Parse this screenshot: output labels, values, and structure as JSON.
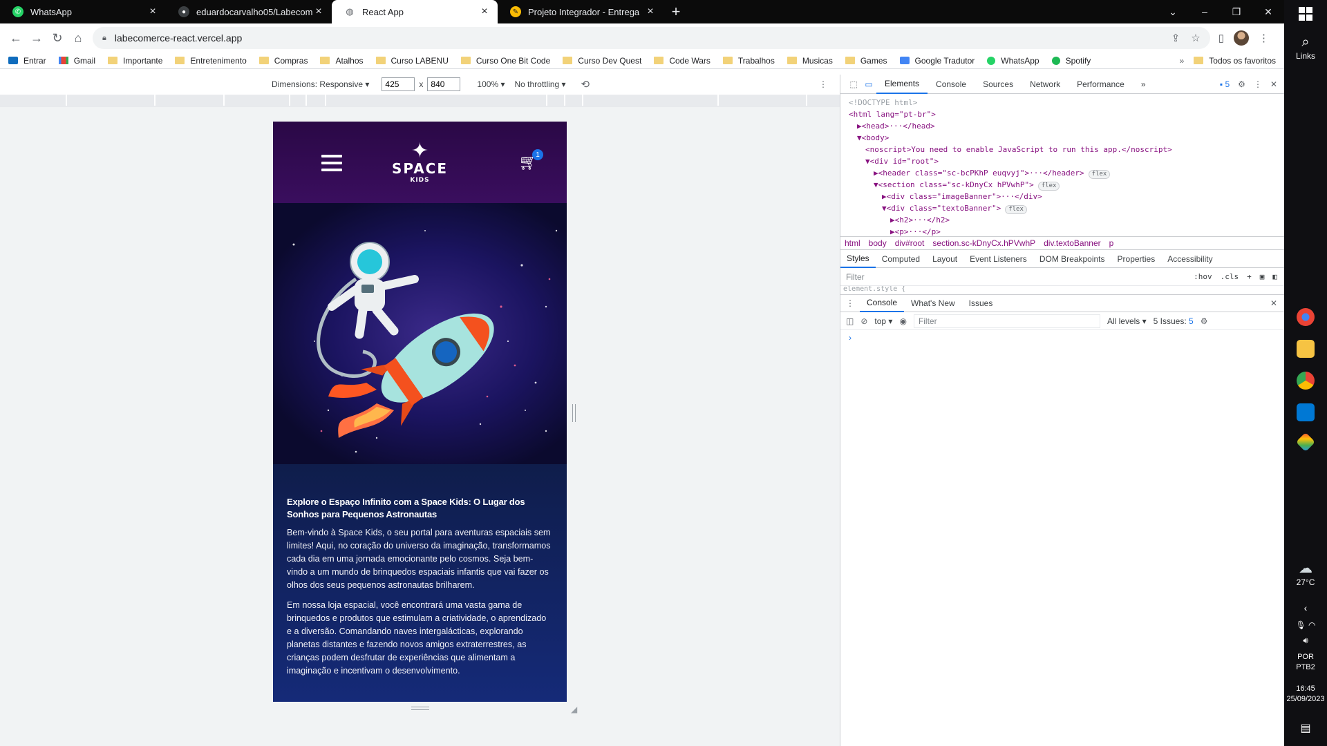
{
  "browser": {
    "tabs": [
      {
        "title": "WhatsApp",
        "favicon": "whatsapp-icon",
        "color": "#25d366"
      },
      {
        "title": "eduardocarvalho05/Labecomerce",
        "favicon": "github-icon",
        "color": "#5f6368"
      },
      {
        "title": "React App",
        "favicon": "globe-icon",
        "color": "#5f6368"
      },
      {
        "title": "Projeto Integrador - Entrega",
        "favicon": "pencil-icon",
        "color": "#fbbc04"
      }
    ],
    "url": "labecomerce-react.vercel.app",
    "bookmarks": [
      {
        "label": "Entrar",
        "icon": "outlook-icon"
      },
      {
        "label": "Gmail",
        "icon": "gmail-icon"
      },
      {
        "label": "Importante",
        "icon": "folder-icon"
      },
      {
        "label": "Entretenimento",
        "icon": "folder-icon"
      },
      {
        "label": "Compras",
        "icon": "folder-icon"
      },
      {
        "label": "Atalhos",
        "icon": "folder-icon"
      },
      {
        "label": "Curso LABENU",
        "icon": "folder-icon"
      },
      {
        "label": "Curso One Bit Code",
        "icon": "folder-icon"
      },
      {
        "label": "Curso Dev Quest",
        "icon": "folder-icon"
      },
      {
        "label": "Code Wars",
        "icon": "folder-icon"
      },
      {
        "label": "Trabalhos",
        "icon": "folder-icon"
      },
      {
        "label": "Musicas",
        "icon": "folder-icon"
      },
      {
        "label": "Games",
        "icon": "folder-icon"
      },
      {
        "label": "Google Tradutor",
        "icon": "translate-icon"
      },
      {
        "label": "WhatsApp",
        "icon": "whatsapp-icon"
      },
      {
        "label": "Spotify",
        "icon": "spotify-icon"
      }
    ],
    "bookmarks_more": "»",
    "all_bookmarks": "Todos os favoritos"
  },
  "device_toolbar": {
    "dimensions_label": "Dimensions: Responsive",
    "width": "425",
    "height": "840",
    "times": "x",
    "zoom": "100%",
    "throttling": "No throttling"
  },
  "site": {
    "logo_name": "SPACE",
    "logo_sub": "KIDS",
    "cart_count": "1",
    "heading": "Explore o Espaço Infinito com a Space Kids: O Lugar dos Sonhos para Pequenos Astronautas",
    "paragraphs": [
      "Bem-vindo à Space Kids, o seu portal para aventuras espaciais sem limites! Aqui, no coração do universo da imaginação, transformamos cada dia em uma jornada emocionante pelo cosmos. Seja bem-vindo a um mundo de brinquedos espaciais infantis que vai fazer os olhos dos seus pequenos astronautas brilharem.",
      "Em nossa loja espacial, você encontrará uma vasta gama de brinquedos e produtos que estimulam a criatividade, o aprendizado e a diversão. Comandando naves intergalácticas, explorando planetas distantes e fazendo novos amigos extraterrestres, as crianças podem desfrutar de experiências que alimentam a imaginação e incentivam o desenvolvimento."
    ]
  },
  "devtools": {
    "tabs": [
      "Elements",
      "Console",
      "Sources",
      "Network",
      "Performance"
    ],
    "more": "»",
    "issues_count": "5",
    "dom_lines": [
      {
        "indent": 0,
        "html": "<!DOCTYPE html>"
      },
      {
        "indent": 0,
        "tag": "<html lang=\"pt-br\">"
      },
      {
        "indent": 1,
        "tag": "▶<head>···</head>"
      },
      {
        "indent": 1,
        "tag": "▼<body>"
      },
      {
        "indent": 2,
        "tag": "<noscript>You need to enable JavaScript to run this app.</noscript>"
      },
      {
        "indent": 2,
        "tag": "▼<div id=\"root\">"
      },
      {
        "indent": 3,
        "tag": "▶<header class=\"sc-bcPKhP euqvyj\">···</header>",
        "pill": "flex"
      },
      {
        "indent": 3,
        "tag": "▼<section class=\"sc-kDnyCx hPVwhP\">",
        "pill": "flex"
      },
      {
        "indent": 4,
        "tag": "▶<div class=\"imageBanner\">···</div>"
      },
      {
        "indent": 4,
        "tag": "▼<div class=\"textoBanner\">",
        "pill": "flex"
      },
      {
        "indent": 5,
        "tag": "▶<h2>···</h2>"
      },
      {
        "indent": 5,
        "tag": "▶<p>···</p>"
      },
      {
        "indent": 5,
        "tag": "▶<p>···</p> == $0"
      }
    ],
    "breadcrumbs": [
      "html",
      "body",
      "div#root",
      "section.sc-kDnyCx.hPVwhP",
      "div.textoBanner",
      "p"
    ],
    "sub_tabs": [
      "Styles",
      "Computed",
      "Layout",
      "Event Listeners",
      "DOM Breakpoints",
      "Properties",
      "Accessibility"
    ],
    "styles_filter_placeholder": "Filter",
    "hov": ":hov",
    "cls": ".cls",
    "element_style": "element.style {",
    "drawer_tabs": [
      "Console",
      "What's New",
      "Issues"
    ],
    "console_context": "top",
    "console_filter_placeholder": "Filter",
    "log_levels": "All levels",
    "issues_label": "5 Issues:",
    "issues_badge": "5",
    "prompt": "›"
  },
  "taskbar": {
    "links_label": "Links",
    "weather_temp": "27°C",
    "weather_badge": "1",
    "lang_1": "POR",
    "lang_2": "PTB2",
    "time": "16:45",
    "date": "25/09/2023"
  }
}
